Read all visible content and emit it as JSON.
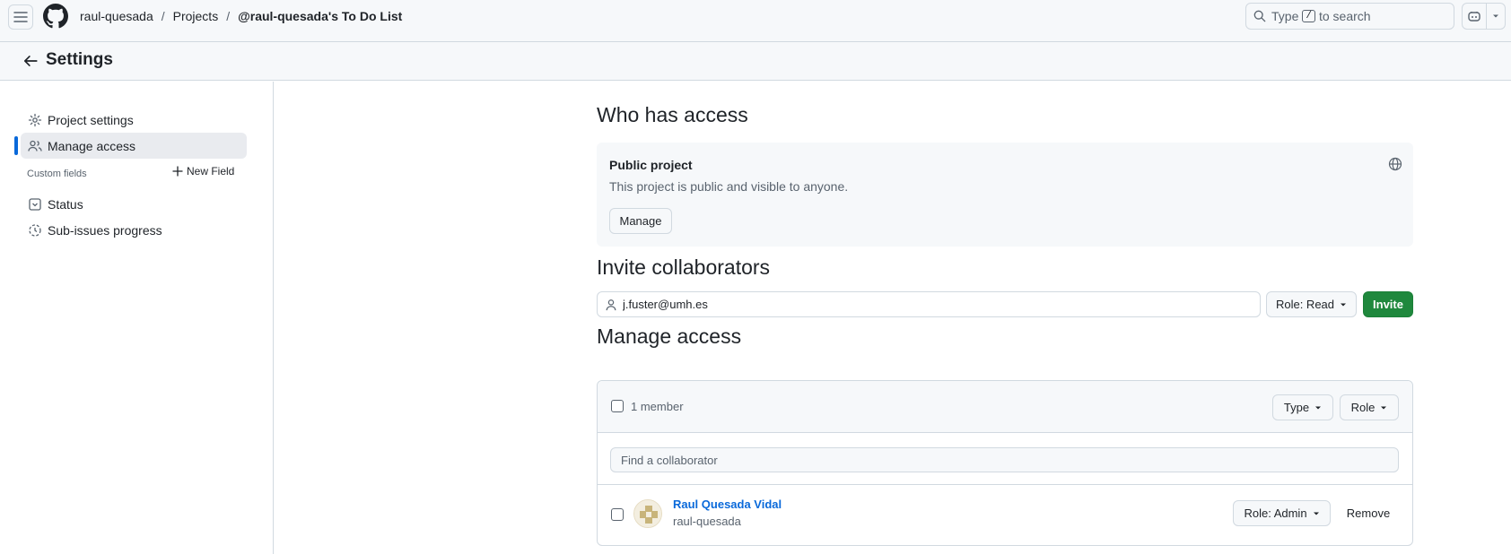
{
  "header": {
    "breadcrumbs": [
      {
        "label": "raul-quesada"
      },
      {
        "label": "Projects"
      },
      {
        "label": "@raul-quesada's To Do List"
      }
    ],
    "separator": "/",
    "search": {
      "prefix": "Type",
      "key": "/",
      "suffix": "to search"
    }
  },
  "settings_bar": {
    "title": "Settings"
  },
  "sidebar": {
    "items": [
      {
        "label": "Project settings",
        "icon": "gear-icon"
      },
      {
        "label": "Manage access",
        "icon": "people-icon",
        "active": true
      }
    ],
    "custom_fields_label": "Custom fields",
    "new_field_label": "New Field",
    "fields": [
      {
        "label": "Status",
        "icon": "single-select-icon"
      },
      {
        "label": "Sub-issues progress",
        "icon": "progress-icon"
      }
    ]
  },
  "main": {
    "who_has_access": {
      "title": "Who has access",
      "box_title": "Public project",
      "box_desc": "This project is public and visible to anyone.",
      "manage_label": "Manage"
    },
    "invite": {
      "title": "Invite collaborators",
      "input_value": "j.fuster@umh.es",
      "role_label": "Role: Read",
      "invite_label": "Invite"
    },
    "manage_access": {
      "title": "Manage access",
      "member_count": "1 member",
      "type_label": "Type",
      "role_label": "Role",
      "find_placeholder": "Find a collaborator",
      "members": [
        {
          "name": "Raul Quesada Vidal",
          "login": "raul-quesada",
          "role": "Role: Admin",
          "remove_label": "Remove"
        }
      ]
    }
  },
  "colors": {
    "accent": "#0969da",
    "invite_green": "#1f883d",
    "border": "#d1d9e0",
    "muted": "#59636e"
  }
}
